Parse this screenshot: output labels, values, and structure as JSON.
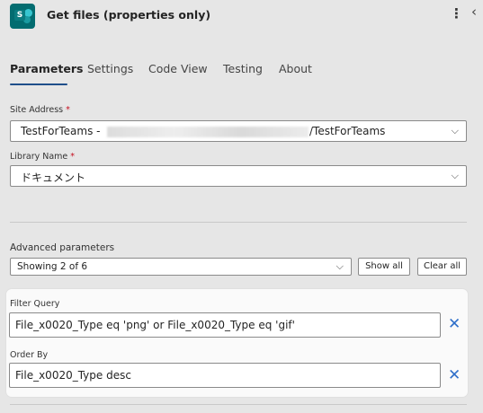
{
  "header": {
    "title": "Get files (properties only)"
  },
  "tabs": [
    {
      "label": "Parameters"
    },
    {
      "label": "Settings"
    },
    {
      "label": "Code View"
    },
    {
      "label": "Testing"
    },
    {
      "label": "About"
    }
  ],
  "site_address": {
    "label": "Site Address",
    "required": "*",
    "value_prefix": "TestForTeams -",
    "value_suffix": "/TestForTeams"
  },
  "library_name": {
    "label": "Library Name",
    "required": "*",
    "value": "ドキュメント"
  },
  "advanced": {
    "label": "Advanced parameters",
    "selected": "Showing 2 of 6",
    "show_all": "Show all",
    "clear_all": "Clear all"
  },
  "filter_query": {
    "label": "Filter Query",
    "value": "File_x0020_Type eq 'png' or File_x0020_Type eq 'gif'"
  },
  "order_by": {
    "label": "Order By",
    "value": "File_x0020_Type desc"
  },
  "icons": {
    "more": "more-vertical-icon",
    "collapse": "chevron-left-icon",
    "dropdown": "chevron-down-icon",
    "clear": "close-icon"
  },
  "colors": {
    "accent": "#1f4f8a",
    "clear_icon": "#2f6fca",
    "required": "#c50f1f"
  }
}
